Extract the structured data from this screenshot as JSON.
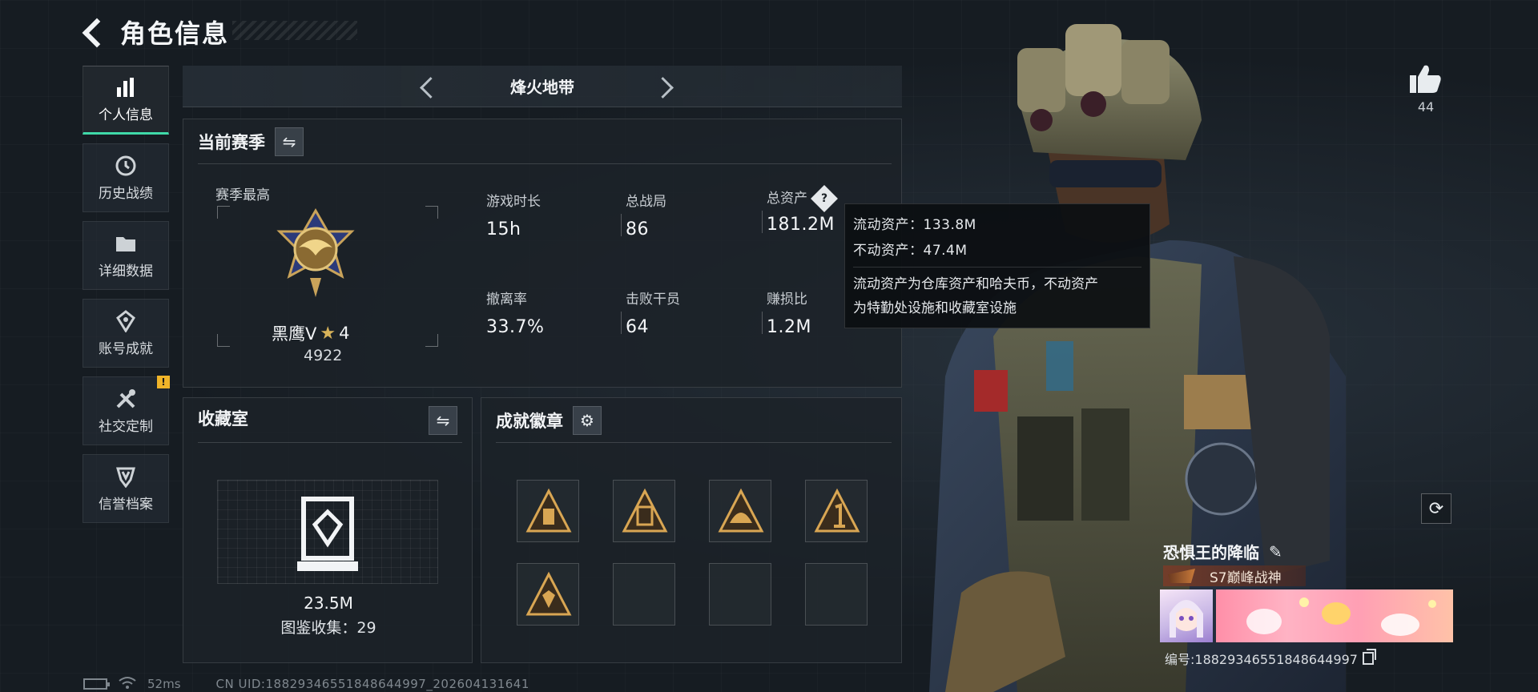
{
  "header": {
    "title": "角色信息",
    "back_icon": "back-arrow-icon"
  },
  "sidebar": {
    "items": [
      {
        "label": "个人信息",
        "icon": "bar-chart-icon",
        "active": true
      },
      {
        "label": "历史战绩",
        "icon": "clock-history-icon",
        "active": false
      },
      {
        "label": "详细数据",
        "icon": "folder-icon",
        "active": false
      },
      {
        "label": "账号成就",
        "icon": "achievement-icon",
        "active": false
      },
      {
        "label": "社交定制",
        "icon": "tools-icon",
        "active": false,
        "alert": "!"
      },
      {
        "label": "信誉档案",
        "icon": "shield-icon",
        "active": false
      }
    ]
  },
  "mode": {
    "name": "烽火地带"
  },
  "season": {
    "title": "当前赛季",
    "best_label": "赛季最高",
    "rank_name": "黑鹰Ⅴ",
    "rank_stars": "4",
    "rank_score": "4922",
    "stats": [
      {
        "label": "游戏时长",
        "value": "15h"
      },
      {
        "label": "总战局",
        "value": "86"
      },
      {
        "label": "总资产",
        "value": "181.2M",
        "help": "?"
      },
      {
        "label": "撤离率",
        "value": "33.7%"
      },
      {
        "label": "击败干员",
        "value": "64"
      },
      {
        "label": "赚损比",
        "value": "1.2M"
      }
    ]
  },
  "tooltip": {
    "liquid": "流动资产：133.8M",
    "fixed": "不动资产：47.4M",
    "desc_line1": "流动资产为仓库资产和哈夫币，不动资产",
    "desc_line2": "为特勤处设施和收藏室设施"
  },
  "collection": {
    "title": "收藏室",
    "value": "23.5M",
    "count_text": "图鉴收集：29"
  },
  "badges": {
    "title": "成就徽章",
    "slots": [
      "badge-lantern-icon",
      "badge-vault-icon",
      "badge-helmet-icon",
      "badge-number-one-icon",
      "badge-shield-icon",
      "",
      "",
      ""
    ]
  },
  "likes": {
    "count": "44"
  },
  "player": {
    "name": "恐惧王的降临",
    "title_text": "S7巅峰战神",
    "id_text": "编号:18829346551848644997"
  },
  "status": {
    "ping": "52ms",
    "uid": "CN UID:18829346551848644997_202604131641"
  },
  "colors": {
    "accent": "#3fd9a8",
    "alert": "#f0b429",
    "gold": "#d8b35a"
  }
}
